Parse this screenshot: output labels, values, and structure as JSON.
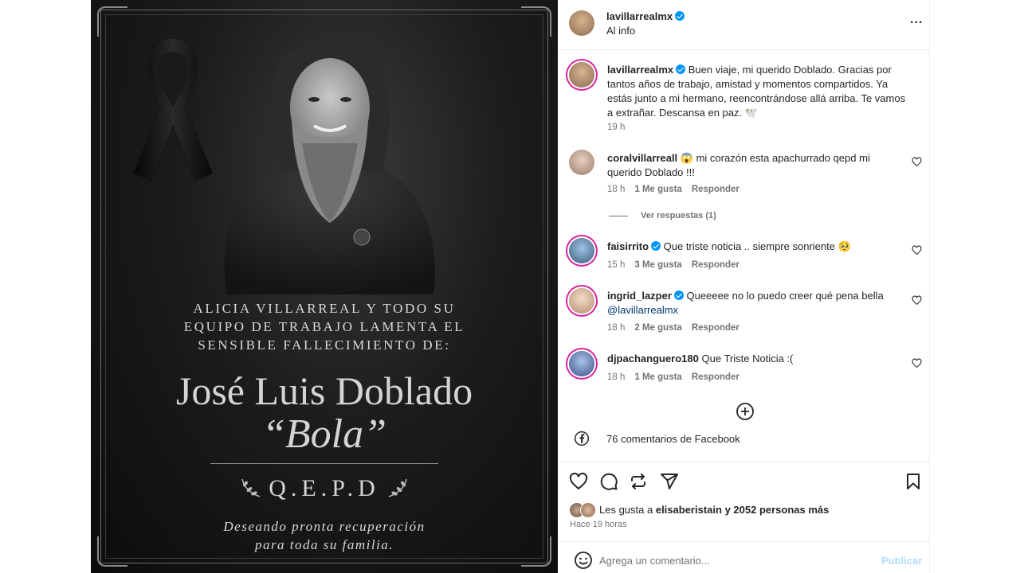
{
  "post": {
    "intro_lines": [
      "ALICIA VILLARREAL Y TODO SU",
      "EQUIPO DE TRABAJO LAMENTA EL",
      "SENSIBLE FALLECIMIENTO DE:"
    ],
    "name": "José Luis Doblado",
    "nickname": "“Bola”",
    "qepd": "Q.E.P.D",
    "wish_lines": [
      "Deseando pronta recuperación",
      "para toda su familia."
    ]
  },
  "header": {
    "username": "lavillarrealmx",
    "subtitle": "Al info",
    "more": "..."
  },
  "caption": {
    "username": "lavillarrealmx",
    "text": "Buen viaje, mi querido Doblado. Gracias por tantos años de trabajo, amistad y momentos compartidos. Ya estás junto a mi hermano, reencontrándose allá arriba. Te vamos a extrañar. Descansa en paz. 🕊️",
    "time": "19 h"
  },
  "comments": [
    {
      "username": "coralvillarreall",
      "verified": false,
      "text": "😱 mi corazón esta apachurrado qepd mi querido Doblado !!!",
      "time": "18 h",
      "likes": "1 Me gusta",
      "reply": "Responder",
      "view_replies": "Ver respuestas (1)"
    },
    {
      "username": "faisirrito",
      "verified": true,
      "text": "Que triste noticia .. siempre sonriente 🥺",
      "time": "15 h",
      "likes": "3 Me gusta",
      "reply": "Responder"
    },
    {
      "username": "ingrid_lazper",
      "verified": true,
      "text": "Queeeee no lo puedo creer qué pena bella",
      "mention": "@lavillarrealmx",
      "time": "18 h",
      "likes": "2 Me gusta",
      "reply": "Responder"
    },
    {
      "username": "djpachanguero180",
      "verified": false,
      "text": "Que Triste Noticia :(",
      "time": "18 h",
      "likes": "1 Me gusta",
      "reply": "Responder"
    }
  ],
  "facebook_comments": "76 comentarios de Facebook",
  "likes": {
    "prefix": "Les gusta a",
    "user": "elisaberistain",
    "suffix": "y 2052 personas más"
  },
  "posted": "Hace 19 horas",
  "add_comment": {
    "placeholder": "Agrega un comentario...",
    "publish": "Publicar"
  },
  "icons": [
    "heart-icon",
    "comment-icon",
    "share-icon",
    "send-icon",
    "bookmark-icon",
    "plus-circle-icon",
    "facebook-icon",
    "emoji-icon",
    "verified-icon"
  ],
  "colors": {
    "verified": "#0095f6",
    "publish": "#b2dffc",
    "mention": "#00376b"
  }
}
